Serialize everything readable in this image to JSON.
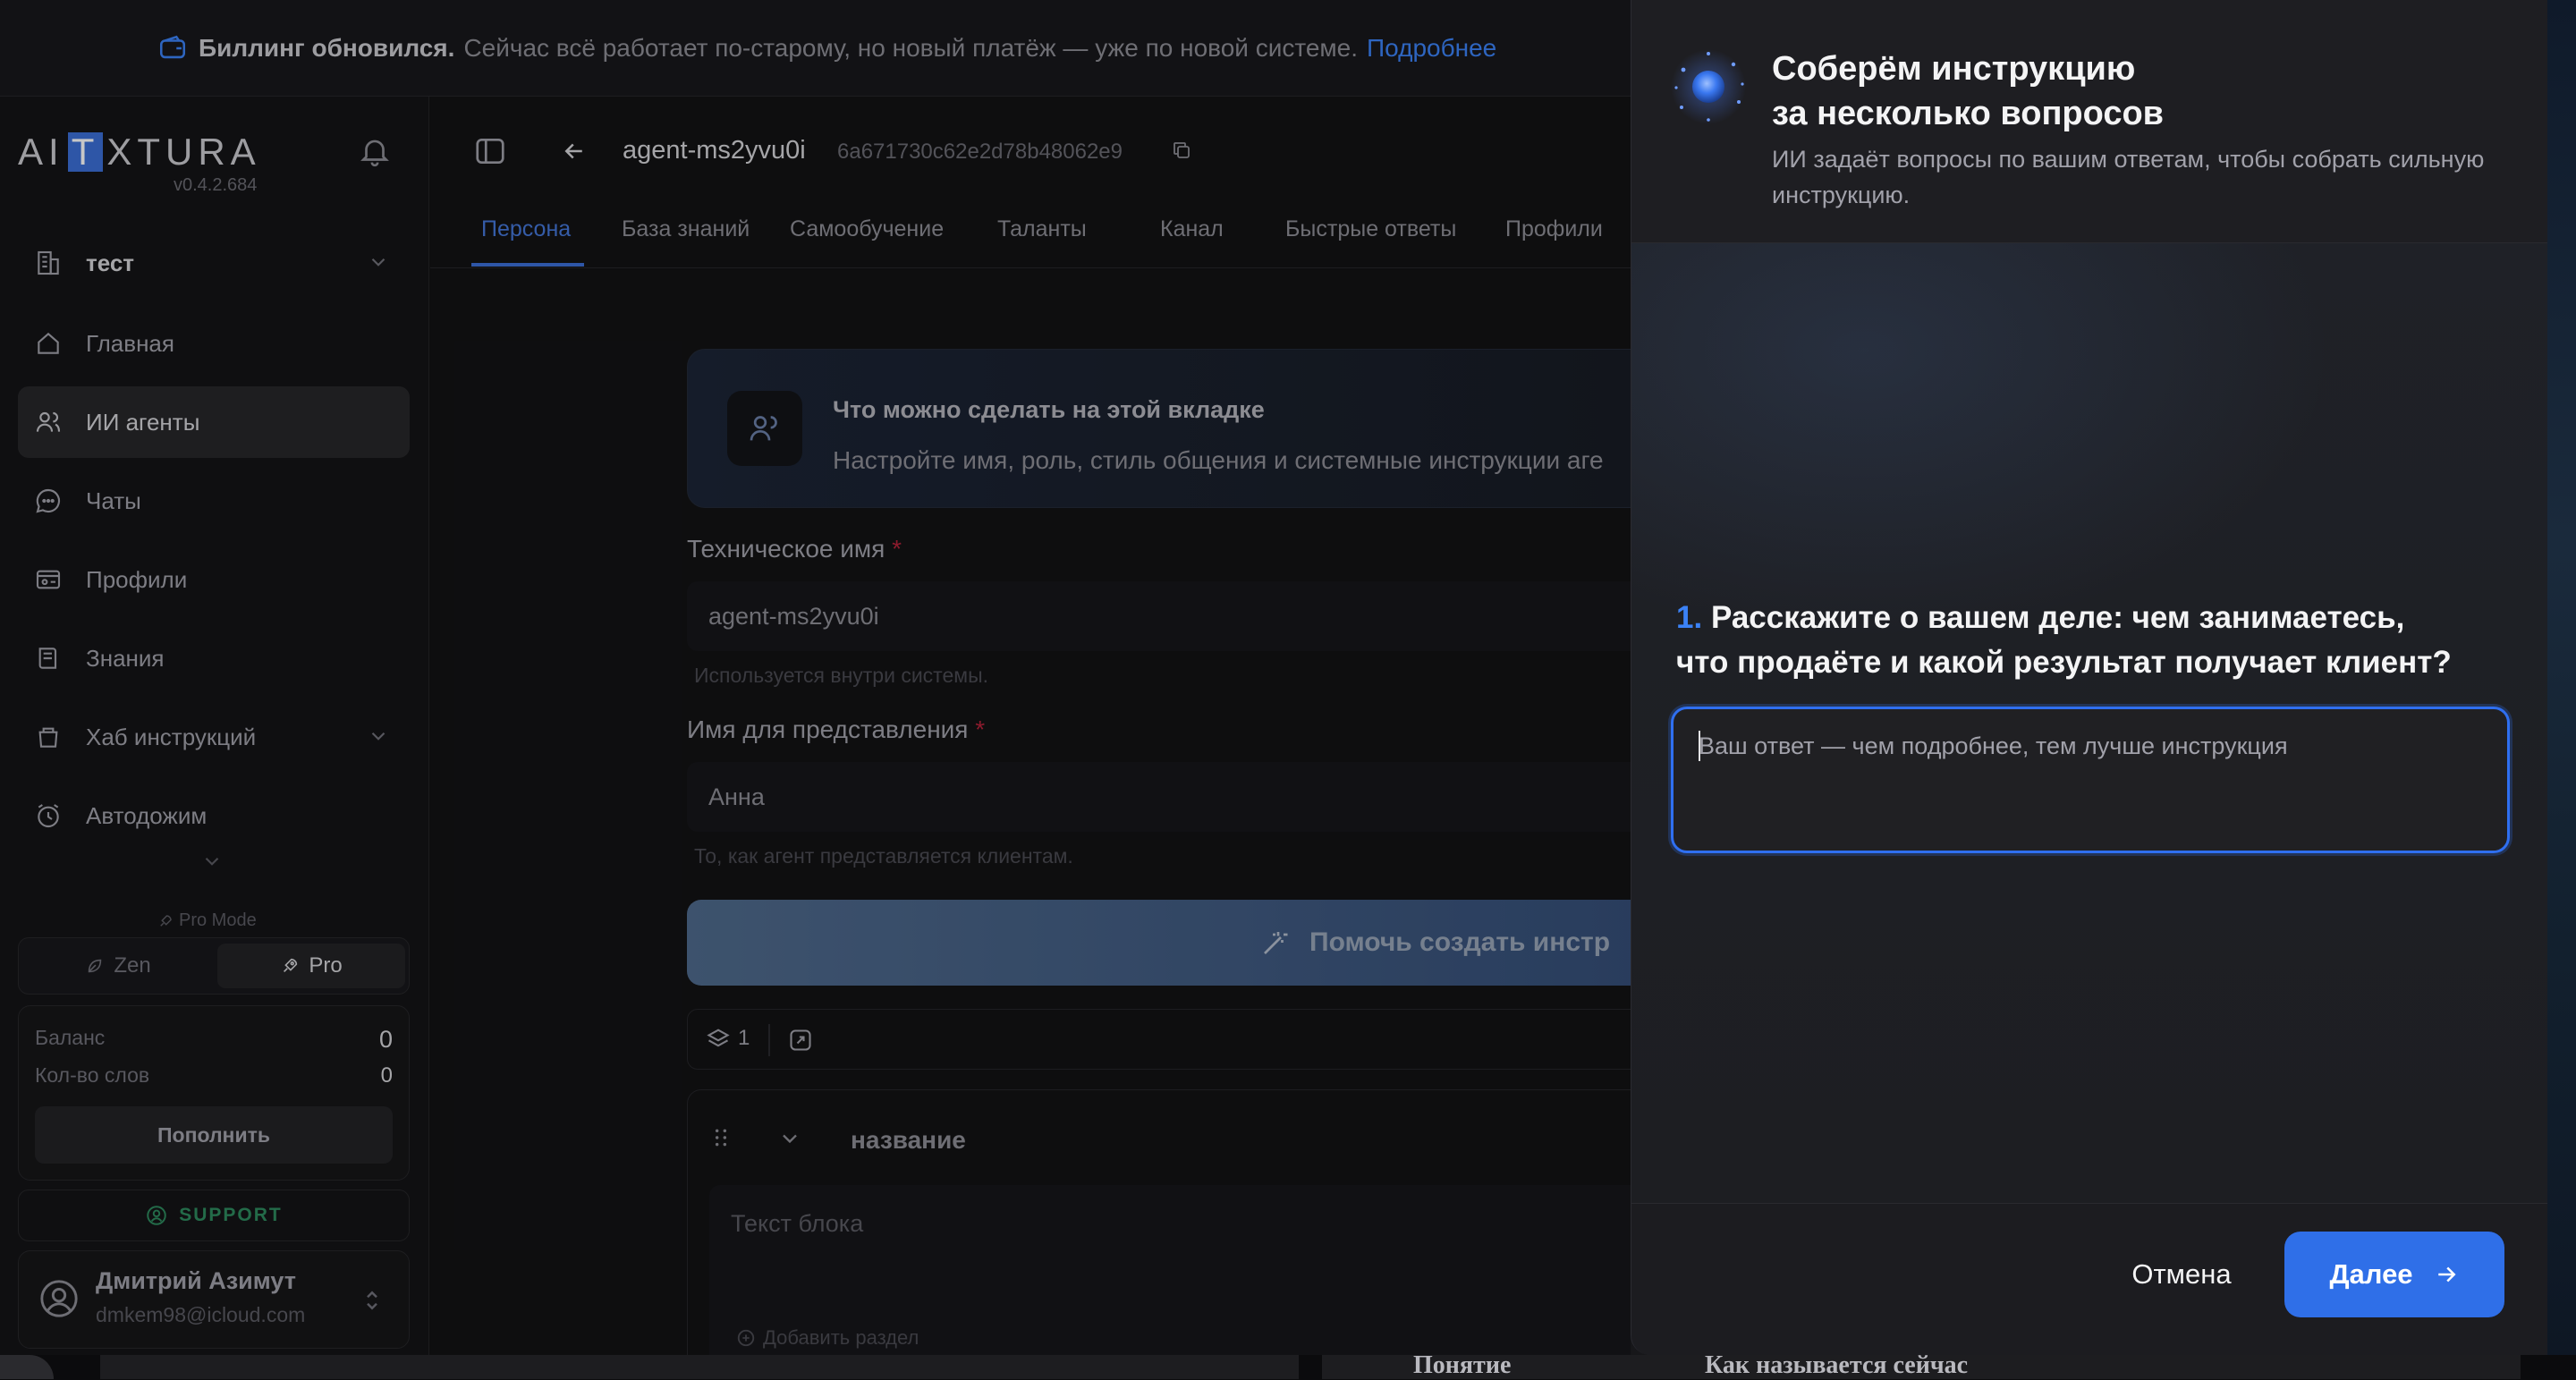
{
  "banner": {
    "title": "Биллинг обновился.",
    "text": "Сейчас всё работает по-старому, но новый платёж — уже по новой системе.",
    "link": "Подробнее"
  },
  "sidebar": {
    "logo": {
      "left": "AI",
      "mid": "T",
      "right": "XTURA"
    },
    "version": "v0.4.2.684",
    "workspace": "тест",
    "items": [
      {
        "label": "Главная",
        "icon": "home-icon"
      },
      {
        "label": "ИИ агенты",
        "icon": "users-icon",
        "active": true
      },
      {
        "label": "Чаты",
        "icon": "chat-icon"
      },
      {
        "label": "Профили",
        "icon": "profile-card-icon"
      },
      {
        "label": "Знания",
        "icon": "book-icon"
      },
      {
        "label": "Хаб инструкций",
        "icon": "hub-icon"
      },
      {
        "label": "Автодожим",
        "icon": "clock-icon"
      }
    ],
    "pro_mode": "Pro Mode",
    "mode_options": [
      "Zen",
      "Pro"
    ],
    "balance": {
      "label": "Баланс",
      "value": "0"
    },
    "words": {
      "label": "Кол-во слов",
      "value": "0"
    },
    "topup": "Пополнить",
    "support": "SUPPORT",
    "user": {
      "name": "Дмитрий Азимут",
      "email": "dmkem98@icloud.com"
    }
  },
  "main": {
    "agent_name": "agent-ms2yvu0i",
    "agent_id": "6a671730c62e2d78b48062e9",
    "tabs": [
      "Персона",
      "База знаний",
      "Самообучение",
      "Таланты",
      "Канал",
      "Быстрые ответы",
      "Профили"
    ],
    "info": {
      "title": "Что можно сделать на этой вкладке",
      "text": "Настройте имя, роль, стиль общения и системные инструкции аге"
    },
    "tech_name": {
      "label": "Техническое имя",
      "value": "agent-ms2yvu0i",
      "hint": "Используется внутри системы."
    },
    "display_name": {
      "label": "Имя для представления",
      "value": "Анна",
      "hint": "То, как агент представляется клиентам."
    },
    "help_button": "Помочь создать инстр",
    "layers_count": "1",
    "block": {
      "title": "название",
      "placeholder": "Текст блока",
      "add_section": "Добавить раздел"
    }
  },
  "behind": {
    "col1": "Понятие",
    "col2": "Как называется сейчас"
  },
  "modal": {
    "title_line1": "Соберём инструкцию",
    "title_line2": "за несколько вопросов",
    "subtitle": "ИИ задаёт вопросы по вашим ответам, чтобы собрать сильную инструкцию.",
    "question_number": "1.",
    "question_line1": "Расскажите о вашем деле: чем занимаетесь,",
    "question_line2": "что продаёте и какой результат получает клиент?",
    "answer_placeholder": "Ваш ответ — чем подробнее, тем лучше инструкция",
    "cancel": "Отмена",
    "next": "Далее"
  },
  "colors": {
    "accent": "#2f6fe8",
    "brand": "#3b6fd6",
    "support": "#2e8a5e"
  }
}
